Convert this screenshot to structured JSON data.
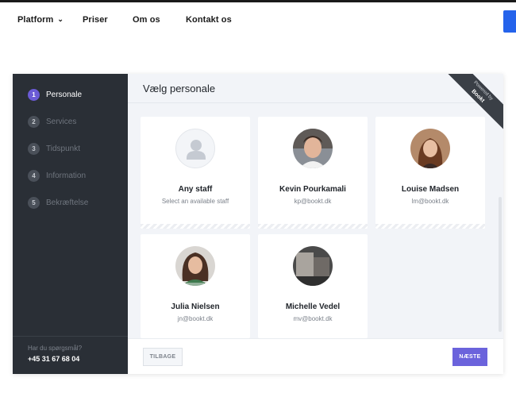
{
  "nav": {
    "items": [
      {
        "label": "Platform",
        "has_dropdown": true
      },
      {
        "label": "Priser"
      },
      {
        "label": "Om os"
      },
      {
        "label": "Kontakt os"
      }
    ],
    "cta_color": "#2563eb"
  },
  "sidebar": {
    "steps": [
      {
        "num": "1",
        "label": "Personale",
        "active": true
      },
      {
        "num": "2",
        "label": "Services"
      },
      {
        "num": "3",
        "label": "Tidspunkt"
      },
      {
        "num": "4",
        "label": "Information"
      },
      {
        "num": "5",
        "label": "Bekræftelse"
      }
    ],
    "question": "Har du spørgsmål?",
    "phone": "+45 31 67 68 04"
  },
  "main": {
    "title": "Vælg personale",
    "ribbon_line1": "Powered by",
    "ribbon_line2": "Bookt"
  },
  "staff": [
    {
      "name": "Any staff",
      "detail": "Select an available staff",
      "avatar": "person-placeholder-icon"
    },
    {
      "name": "Kevin Pourkamali",
      "detail": "kp@bookt.dk",
      "avatar": "photo"
    },
    {
      "name": "Louise Madsen",
      "detail": "lm@bookt.dk",
      "avatar": "photo"
    },
    {
      "name": "Julia Nielsen",
      "detail": "jn@bookt.dk",
      "avatar": "photo"
    },
    {
      "name": "Michelle Vedel",
      "detail": "mv@bookt.dk",
      "avatar": "photo"
    }
  ],
  "footer": {
    "back_label": "TILBAGE",
    "next_label": "NÆSTE"
  },
  "colors": {
    "accent": "#6b63dc",
    "sidebar_bg": "#2a2f36"
  }
}
